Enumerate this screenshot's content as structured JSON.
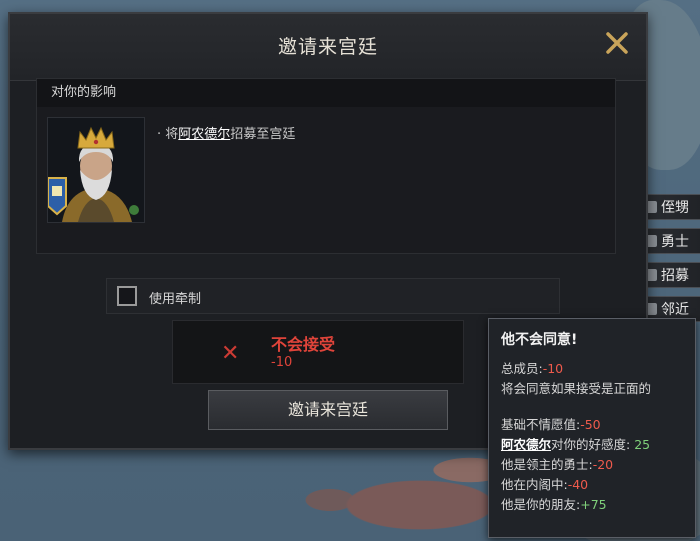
{
  "dialog": {
    "title": "邀请来宫廷",
    "effect_header": "对你的影响",
    "effect_bullet": "·",
    "effect_prefix": "将",
    "effect_name": "阿农德尔",
    "effect_suffix": "招募至宫廷",
    "checkbox_label": "使用牵制",
    "verdict_text": "不会接受",
    "verdict_value": "-10",
    "button_label": "邀请来宫廷"
  },
  "side_items": [
    {
      "label": "侄甥"
    },
    {
      "label": "勇士"
    },
    {
      "label": "招募"
    },
    {
      "label": "邻近"
    }
  ],
  "tooltip": {
    "title": "他不会同意!",
    "total_label": "总成员:",
    "total_value": "-10",
    "condition": "将会同意如果接受是正面的",
    "rows": [
      {
        "label": "基础不情愿值:",
        "value": "-50",
        "name": ""
      },
      {
        "label": "对你的好感度:",
        "value": "25",
        "name": "阿农德尔"
      },
      {
        "label": "他是领主的勇士:",
        "value": "-20",
        "name": ""
      },
      {
        "label": "他在内阁中:",
        "value": "-40",
        "name": ""
      },
      {
        "label": "他是你的朋友:",
        "value": "+75",
        "name": ""
      }
    ]
  },
  "colors": {
    "negative": "#ee5a4c",
    "positive": "#7fd07a",
    "close_x": "#c9a45a"
  },
  "icons": [
    "close-icon",
    "crown-portrait",
    "banner-icon",
    "x-icon",
    "checkbox"
  ]
}
